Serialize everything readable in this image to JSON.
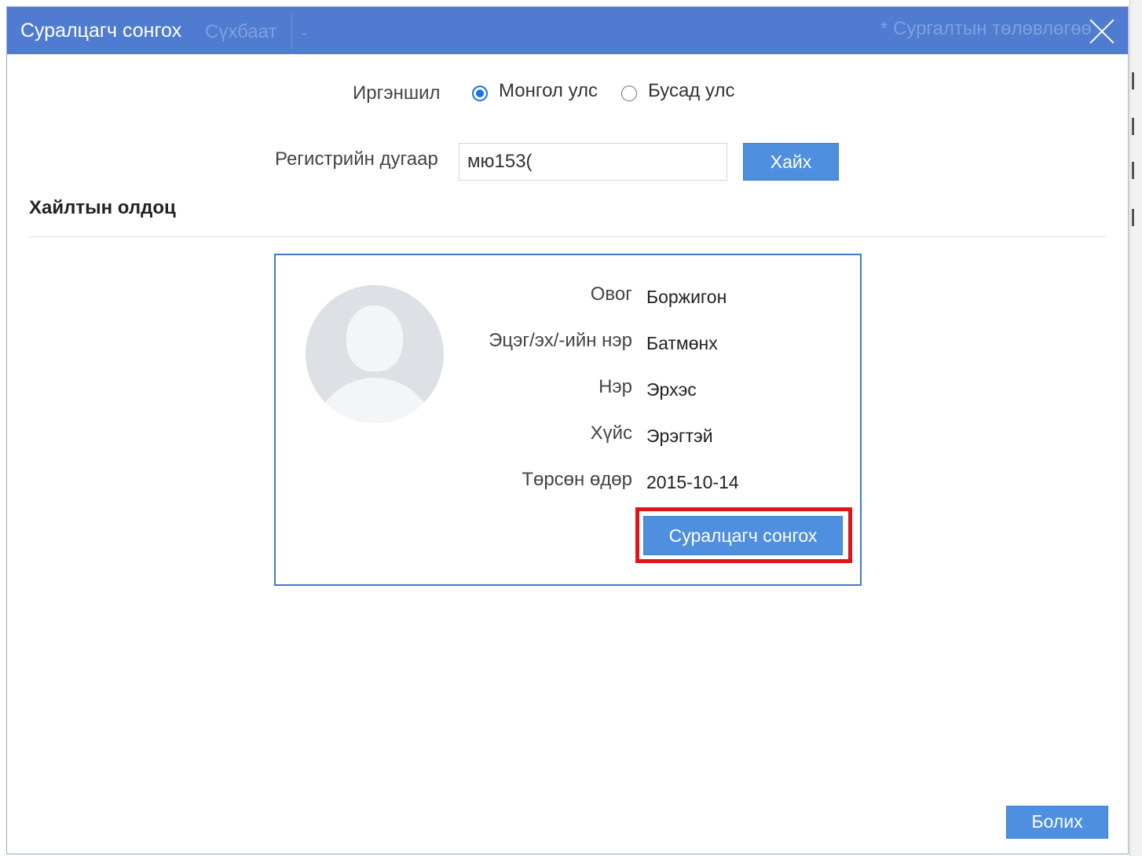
{
  "dialog": {
    "title": "Суралцагч сонгох",
    "ghost_left_text": "Сүхбаат",
    "ghost_right_text": "* Сургалтын төлөвлөгөө"
  },
  "form": {
    "citizenship_label": "Иргэншил",
    "citizenship_options": [
      {
        "label": "Монгол улс",
        "checked": true
      },
      {
        "label": "Бусад улс",
        "checked": false
      }
    ],
    "register_label": "Регистрийн дугаар",
    "register_value": "мю153(",
    "search_button": "Хайх"
  },
  "results": {
    "section_title": "Хайлтын олдоц",
    "fields": [
      {
        "label": "Овог",
        "value": "Боржигон"
      },
      {
        "label": "Эцэг/эх/-ийн нэр",
        "value": "Батмөнх"
      },
      {
        "label": "Нэр",
        "value": "Эрхэс"
      },
      {
        "label": "Хүйс",
        "value": "Эрэгтэй"
      },
      {
        "label": "Төрсөн өдөр",
        "value": "2015-10-14"
      }
    ],
    "select_button": "Суралцагч сонгох"
  },
  "footer": {
    "close_button": "Болих"
  },
  "colors": {
    "titlebar": "#4f7bd0",
    "button": "#4f8fe0",
    "highlight": "#e0141e",
    "card_border": "#3d7bd0"
  },
  "icons": {
    "close": "close-icon",
    "avatar": "user-avatar-icon"
  }
}
